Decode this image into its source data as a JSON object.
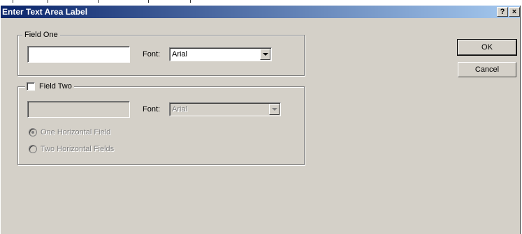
{
  "dialog": {
    "title": "Enter Text Area Label",
    "help_label": "?",
    "close_label": "×"
  },
  "field_one": {
    "legend": "Field One",
    "text_value": "",
    "font_label": "Font:",
    "font_value": "Arial"
  },
  "field_two": {
    "legend": "Field Two",
    "checked": false,
    "text_value": "",
    "font_label": "Font:",
    "font_value": "Arial",
    "options": [
      {
        "label": "One Horizontal Field",
        "selected": true
      },
      {
        "label": "Two Horizontal Fields",
        "selected": false
      }
    ]
  },
  "buttons": {
    "ok": "OK",
    "cancel": "Cancel"
  }
}
